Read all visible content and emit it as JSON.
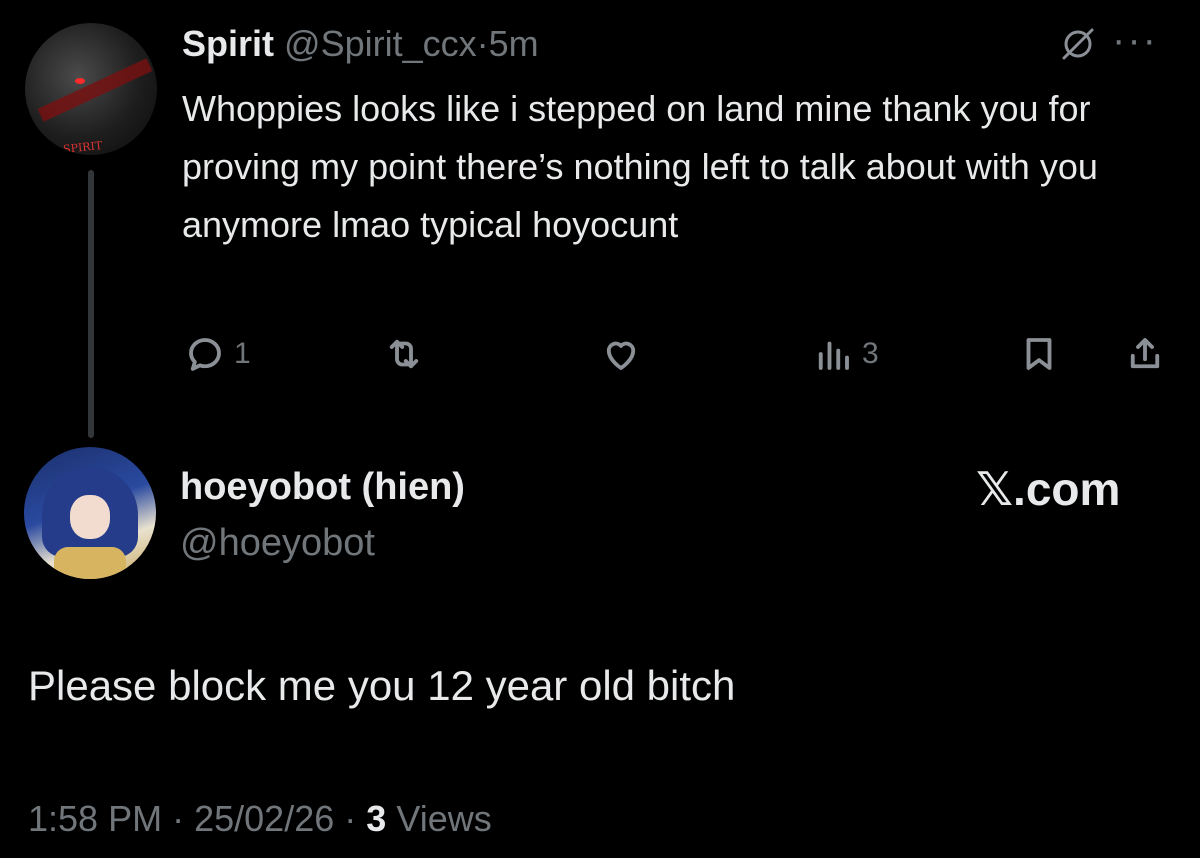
{
  "parent_tweet": {
    "name": "Spirit",
    "handle": "@Spirit_ccx",
    "separator": "·",
    "time": "5m",
    "avatar_tag": "SPIRIT",
    "text": "Whoppies looks like i stepped on land mine thank you for proving my point there’s nothing left to talk about with you anymore lmao typical hoyocunt",
    "actions": {
      "reply_count": "1",
      "views_count": "3"
    },
    "icons": [
      "grok-icon",
      "more-icon",
      "reply-icon",
      "retweet-icon",
      "like-icon",
      "views-icon",
      "bookmark-icon",
      "share-icon"
    ]
  },
  "reply_tweet": {
    "name": "hoeyobot (hien)",
    "handle": "@hoeyobot",
    "brand": "𝕏.com",
    "text": "Please block me you 12 year old bitch"
  },
  "meta": {
    "time": "1:58 PM",
    "sep1": "·",
    "date": "25/02/26",
    "sep2": "·",
    "views_count": "3",
    "views_label": "Views"
  },
  "colors": {
    "background": "#000000",
    "text": "#e7e9ea",
    "muted": "#71767b"
  }
}
